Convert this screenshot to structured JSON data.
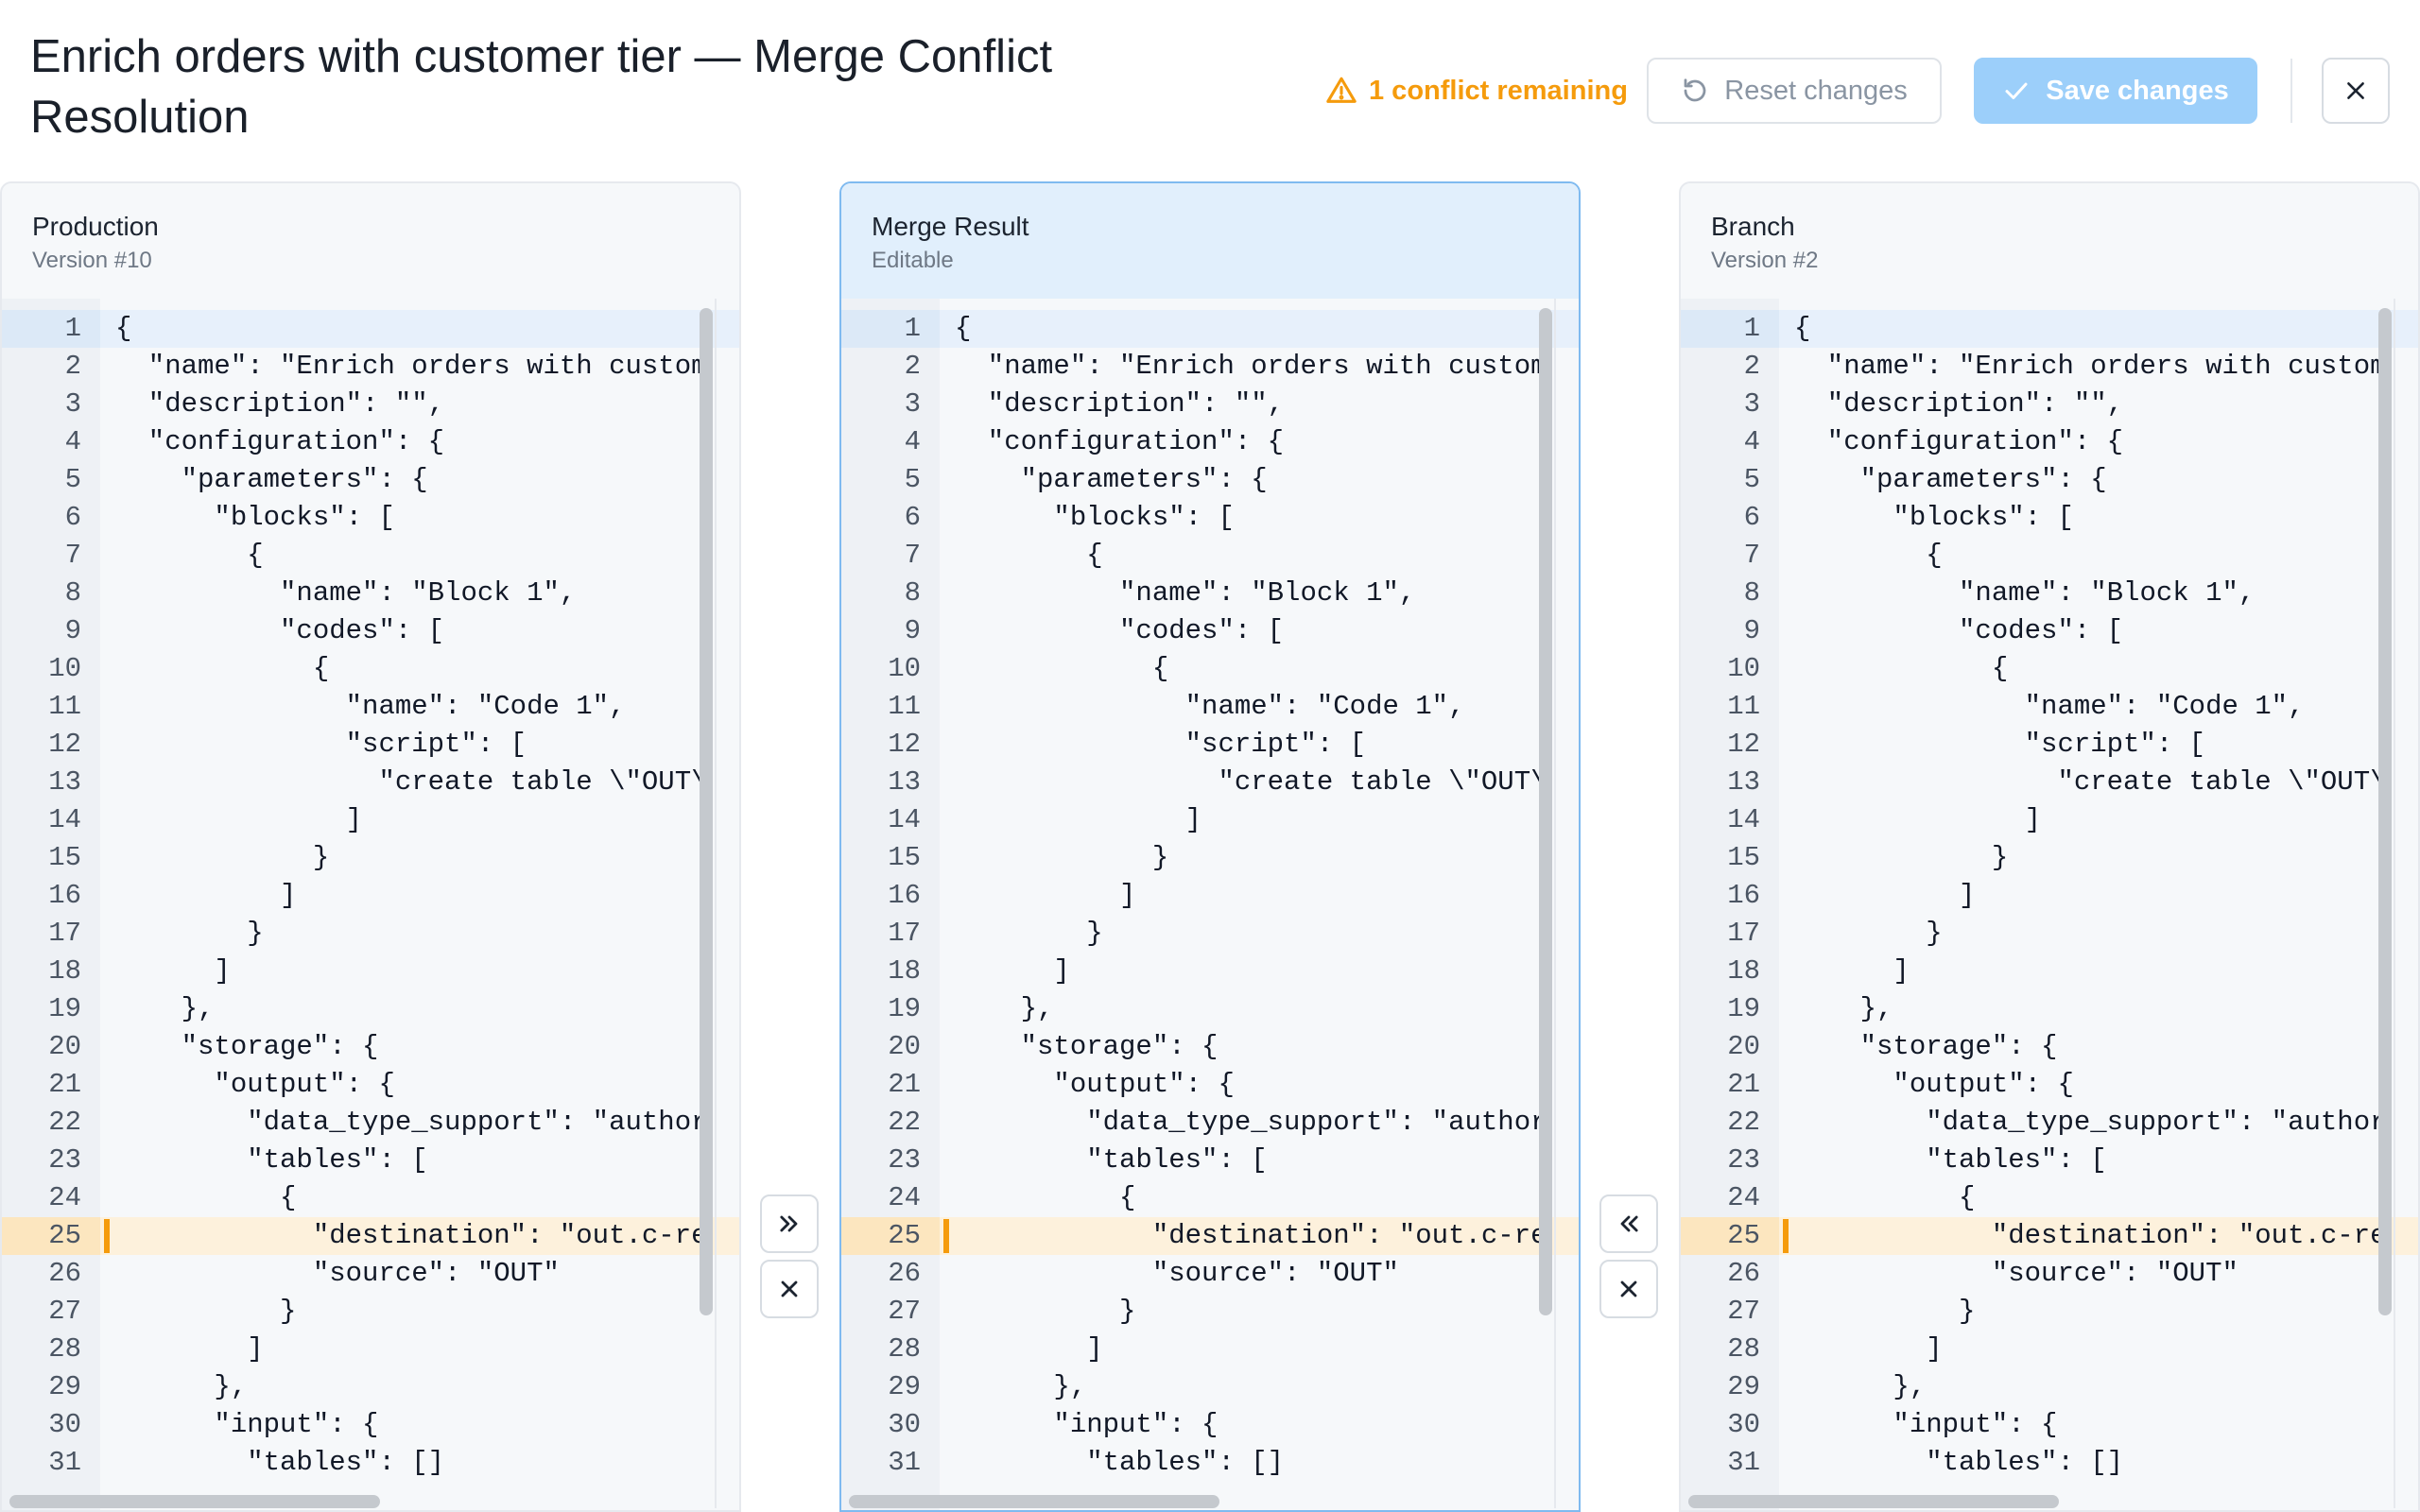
{
  "header": {
    "title": "Enrich orders with customer tier — Merge Conflict Resolution",
    "conflict_status": "1 conflict remaining",
    "reset_label": "Reset changes",
    "save_label": "Save changes"
  },
  "colors": {
    "warning": "#f59b0c",
    "save_button": "#9ccffa",
    "merge_header": "#e1effc",
    "conflict_line": "#fdf1dc"
  },
  "panels": {
    "left": {
      "name": "Production",
      "subtitle": "Version #10"
    },
    "middle": {
      "name": "Merge Result",
      "subtitle": "Editable"
    },
    "right": {
      "name": "Branch",
      "subtitle": "Version #2"
    }
  },
  "editor": {
    "active_line": 1,
    "conflict_line": 25,
    "lines": [
      "{",
      "  \"name\": \"Enrich orders with customer tier\",",
      "  \"description\": \"\",",
      "  \"configuration\": {",
      "    \"parameters\": {",
      "      \"blocks\": [",
      "        {",
      "          \"name\": \"Block 1\",",
      "          \"codes\": [",
      "            {",
      "              \"name\": \"Code 1\",",
      "              \"script\": [",
      "                \"create table \\\"OUT\\\"",
      "              ]",
      "            }",
      "          ]",
      "        }",
      "      ]",
      "    },",
      "    \"storage\": {",
      "      \"output\": {",
      "        \"data_type_support\": \"authoritative\",",
      "        \"tables\": [",
      "          {",
      "            \"destination\": \"out.c-reports\",",
      "            \"source\": \"OUT\"",
      "          }",
      "        ]",
      "      },",
      "      \"input\": {",
      "        \"tables\": []"
    ]
  },
  "icons": {
    "warning": "warning-triangle-icon",
    "reset": "rotate-ccw-icon",
    "save": "check-icon",
    "close": "close-icon",
    "accept_left": "chevrons-right-icon",
    "accept_right": "chevrons-left-icon",
    "reject": "close-icon"
  }
}
